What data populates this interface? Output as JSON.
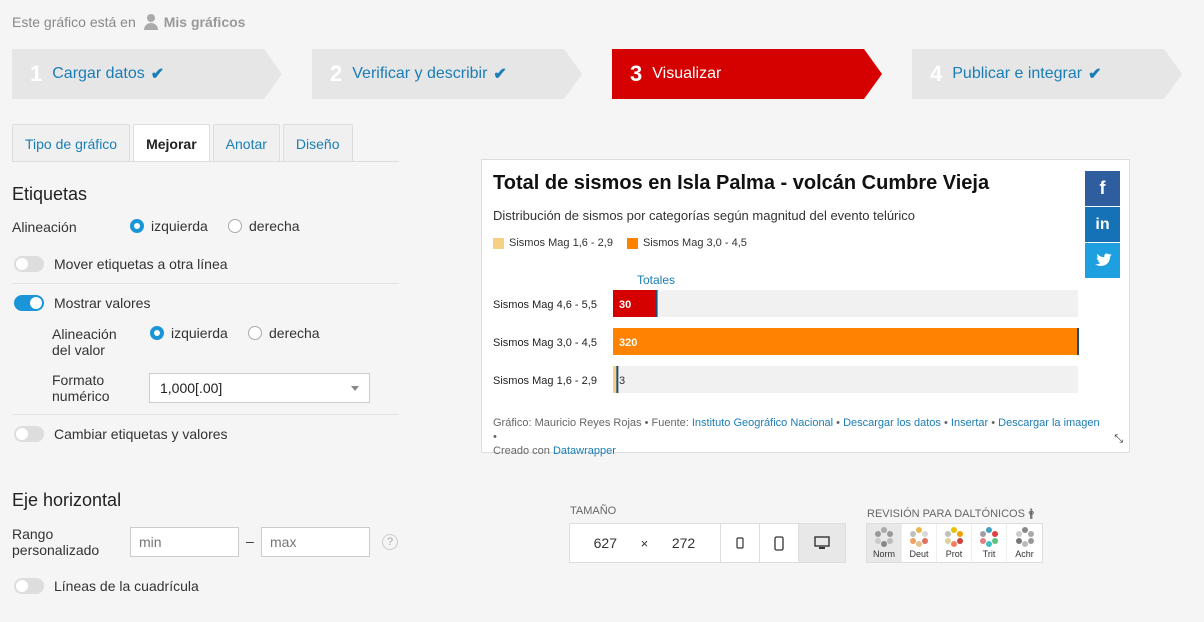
{
  "top": {
    "prefix": "Este gráfico está en",
    "owner": "Mis gráficos"
  },
  "steps": [
    {
      "num": "1",
      "label": "Cargar datos",
      "state": "done"
    },
    {
      "num": "2",
      "label": "Verificar y describir",
      "state": "done"
    },
    {
      "num": "3",
      "label": "Visualizar",
      "state": "active"
    },
    {
      "num": "4",
      "label": "Publicar e integrar",
      "state": "done"
    }
  ],
  "check_glyph": "✔",
  "tabs": [
    "Tipo de gráfico",
    "Mejorar",
    "Anotar",
    "Diseño"
  ],
  "labels_section": {
    "title": "Etiquetas",
    "alignment_label": "Alineación",
    "align_left": "izquierda",
    "align_right": "derecha",
    "move_labels": "Mover etiquetas a otra línea",
    "show_values": "Mostrar valores",
    "value_alignment_label": "Alineación del valor",
    "value_align_left": "izquierda",
    "value_align_right": "derecha",
    "number_format_label": "Formato numérico",
    "number_format_value": "1,000[.00]",
    "swap_labels": "Cambiar etiquetas y valores"
  },
  "axis_section": {
    "title": "Eje horizontal",
    "range_label": "Rango personalizado",
    "min_placeholder": "min",
    "dash": "–",
    "max_placeholder": "max",
    "help": "?",
    "gridlines": "Líneas de la cuadrícula"
  },
  "chart": {
    "title": "Total de sismos en Isla Palma - volcán Cumbre Vieja",
    "subtitle": "Distribución de sismos por categorías según magnitud del evento telúrico",
    "legend": [
      {
        "label": "Sismos Mag 1,6 - 2,9",
        "color": "#f6d083"
      },
      {
        "label": "Sismos Mag 3,0 - 4,5",
        "color": "#ff8200"
      }
    ],
    "column_header": "Totales",
    "footer": {
      "prefix": "Gráfico: Mauricio Reyes Rojas • Fuente: ",
      "source": "Instituto Geográfico Nacional",
      "sep1": " • ",
      "download_data": "Descargar los datos",
      "sep2": " • ",
      "embed": "Insertar",
      "sep3": " • ",
      "download_image": "Descargar la imagen",
      "sep4": " •",
      "created_prefix": "Creado con ",
      "created_tool": "Datawrapper"
    },
    "social": [
      {
        "name": "facebook",
        "glyph": "f",
        "color": "#2f5e9e"
      },
      {
        "name": "linkedin",
        "glyph": "in",
        "color": "#1572b6"
      },
      {
        "name": "twitter",
        "glyph": "🐦",
        "color": "#1d9fe0"
      }
    ]
  },
  "chart_data": {
    "type": "bar",
    "categories": [
      "Sismos Mag 4,6 - 5,5",
      "Sismos Mag 3,0 - 4,5",
      "Sismos Mag 1,6 - 2,9"
    ],
    "values": [
      30,
      320,
      3
    ],
    "colors": [
      "#d50000",
      "#ff8200",
      "#f6d083"
    ],
    "xlim": [
      0,
      320
    ],
    "title": "Total de sismos en Isla Palma - volcán Cumbre Vieja",
    "column_header": "Totales"
  },
  "size": {
    "label": "Tamaño",
    "width": "627",
    "times": "×",
    "height": "272"
  },
  "colorblind": {
    "label": "Revisión para daltónicos",
    "options": [
      "Norm",
      "Deut",
      "Prot",
      "Trit",
      "Achr"
    ]
  }
}
